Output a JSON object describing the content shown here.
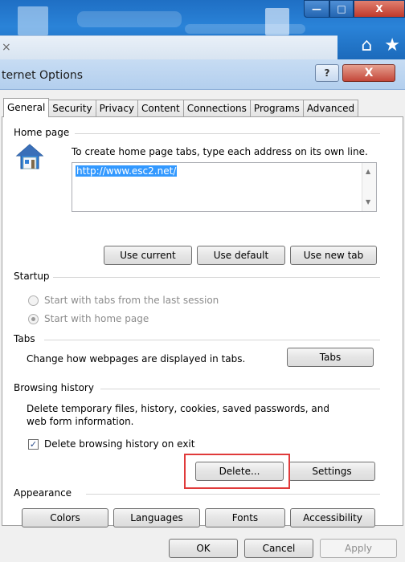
{
  "browser": {
    "tab_close": "×",
    "toolbar_icons": "⌂ ★ ⚙",
    "window_buttons": {
      "minimize": "—",
      "maximize": "□",
      "close": "X"
    }
  },
  "dialog": {
    "title": "ternet Options",
    "help": "?",
    "close": "X"
  },
  "tabs": [
    "General",
    "Security",
    "Privacy",
    "Content",
    "Connections",
    "Programs",
    "Advanced"
  ],
  "home_page": {
    "label": "Home page",
    "instruction": "To create home page tabs, type each address on its own line.",
    "url": "http://www.esc2.net/",
    "buttons": {
      "use_current": "Use current",
      "use_default": "Use default",
      "use_new_tab": "Use new tab"
    }
  },
  "startup": {
    "label": "Startup",
    "option_last_session": "Start with tabs from the last session",
    "option_home_page": "Start with home page",
    "selected": "Start with home page"
  },
  "tabs_group": {
    "label": "Tabs",
    "description": "Change how webpages are displayed in tabs.",
    "button": "Tabs"
  },
  "browsing_history": {
    "label": "Browsing history",
    "description_line1": "Delete temporary files, history, cookies, saved passwords, and",
    "description_line2": "web form information.",
    "checkbox_label": "Delete browsing history on exit",
    "checkbox_checked": true,
    "delete_button": "Delete...",
    "settings_button": "Settings"
  },
  "appearance": {
    "label": "Appearance",
    "buttons": [
      "Colors",
      "Languages",
      "Fonts",
      "Accessibility"
    ]
  },
  "footer": {
    "ok": "OK",
    "cancel": "Cancel",
    "apply": "Apply"
  },
  "colors": {
    "highlight": "#e03a3a",
    "selection": "#3399ff",
    "title_bar": "#b3cfee",
    "browser_bar": "#2a83d8"
  }
}
